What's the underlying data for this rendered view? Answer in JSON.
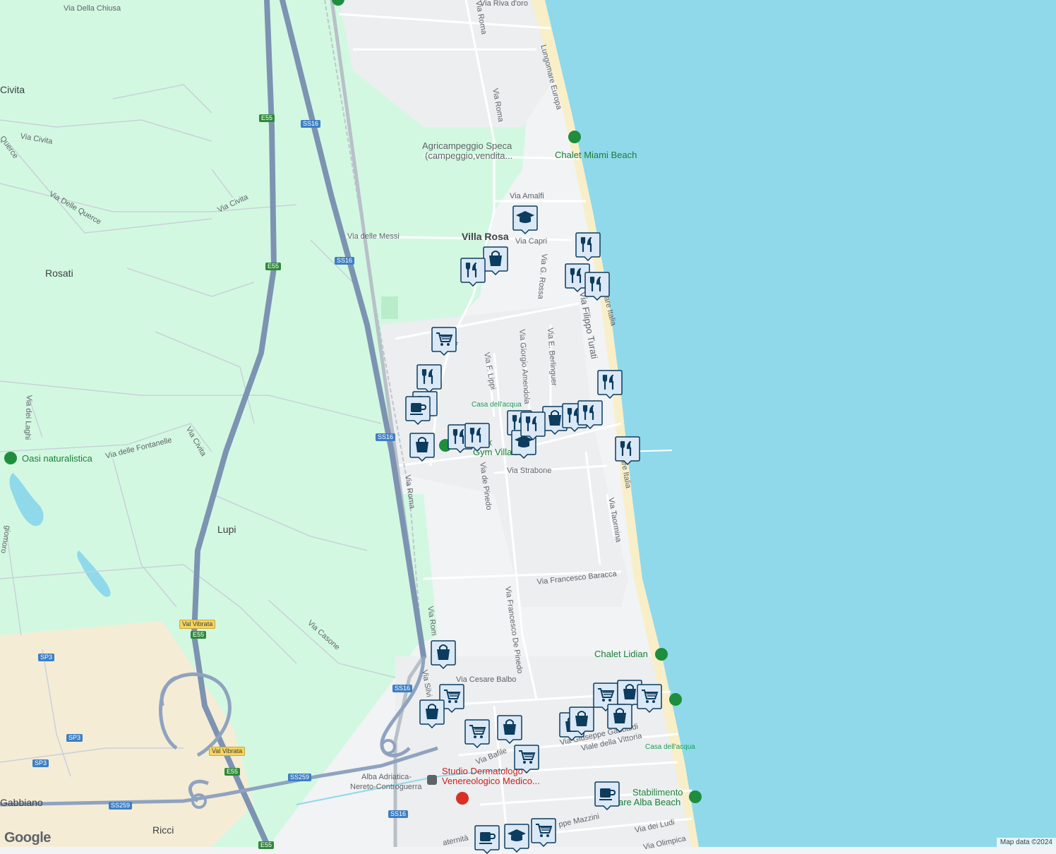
{
  "colors": {
    "sea": "#8fd9ea",
    "land": "#f1f3f4",
    "green": "#d3f8e2",
    "farmland": "#f5ecd6",
    "highway": "#7d93b2",
    "road": "#ffffff",
    "beach": "#f8efc9",
    "pin": "#0c3c5e",
    "pin_fill": "#dbe8f5"
  },
  "places": {
    "civita": "Civita",
    "rosati": "Rosati",
    "lupi": "Lupi",
    "villa_rosa": "Villa Rosa",
    "gabbiano": "Gabbiano",
    "ricci": "Ricci"
  },
  "streets": {
    "via_della_chiusa": "Via Della Chiusa",
    "via_riva_doro": "Via Riva d'oro",
    "via_roma_1": "Via Roma",
    "via_roma_2": "Via Roma",
    "via_roma_3": "Via Roma",
    "via_roma_4": "Via Rom",
    "lungomare_europa": "Lungomare Europa",
    "via_civita_1": "Via Civita",
    "via_civita_2": "Via Civita",
    "via_civita_3": "Via Civita",
    "via_quercie": "Querce",
    "via_delle_querce": "Via Delle Querce",
    "via_amalfi": "Via Amalfi",
    "via_delle_messi": "Via delle Messi",
    "via_capri": "Via Capri",
    "via_g_rossa": "Via G. Rossa",
    "via_filippo_turati": "Via Filippo Turati",
    "lungomare_italia_1": "omare Italia",
    "lungomare_italia_2": "mare Italia",
    "via_giorgio_amendola": "Via Giorgio Amendola",
    "via_e_berlinguer": "Via E. Berlinguer",
    "via_f_lippi": "Via F. Lippi",
    "via_dei_laghi": "Via dei Laghi",
    "via_delle_fontanelle": "Via delle Fontanelle",
    "via_strabone": "Via Strabone",
    "via_de_pinedo": "Via de Pinedo",
    "via_taormina": "Via Taormina",
    "via_francesco_baracca": "Via Francesco Baracca",
    "via_francesco_de_pinedo": "Via Francesco De Pinedo",
    "via_casone": "Via Casone",
    "via_cesare_balbo": "Via Cesare Balbo",
    "via_silvio": "Via Silvi",
    "via_bafile": "Via Bafile",
    "viale_della_vittoria": "Viale della Vittoria",
    "via_giuseppe_garibaldi": "Via Giuseppe Garibaldi",
    "via_mazzini": "ppe Mazzini",
    "via_dei_ludi": "Via dei Ludi",
    "via_olimpica": "Via Olimpica",
    "via_maternita": "aternità",
    "giomoro": "giomoro",
    "via_vita": "Via"
  },
  "pois": {
    "agricampeggio_line1": "Agricampeggio Speca",
    "agricampeggio_line2": "(campeggio,vendita...",
    "chalet_miami_beach": "Chalet Miami Beach",
    "oasi_naturalistica": "Oasi naturalistica",
    "casa_acqua_1": "Casa dell'acqua",
    "casa_acqua_2": "Casa dell'acqua",
    "gym_line1": "Lux",
    "gym_line2": "Gym Villa Ro...",
    "chalet_lidian": "Chalet Lidian",
    "alba_station_line1": "Alba Adriatica-",
    "alba_station_line2": "Nereto-Controguerra",
    "studio_line1": "Studio Dermatologo",
    "studio_line2": "Venereologico Medico...",
    "stabilimento_line1": "Stabilimento",
    "stabilimento_line2": "are Alba Beach"
  },
  "shields": {
    "e55_a": "E55",
    "ss16_a": "SS16",
    "e55_b": "E55",
    "ss16_b": "SS16",
    "ss16_c": "SS16",
    "val_vibrata_a": "Val Vibrata",
    "e55_c": "E55",
    "sp3_a": "SP3",
    "ss16_d": "SS16",
    "sp3_b": "SP3",
    "sp3_c": "SP3",
    "val_vibrata_b": "Val Vibrata",
    "e55_d": "E55",
    "ss259_a": "SS259",
    "ss259_b": "SS259",
    "ss16_e": "SS16",
    "e55_e": "E55"
  },
  "pins": [
    {
      "icon": "school-icon"
    },
    {
      "icon": "restaurant-icon"
    },
    {
      "icon": "shopping-icon"
    },
    {
      "icon": "restaurant-icon"
    },
    {
      "icon": "restaurant-icon"
    },
    {
      "icon": "restaurant-icon"
    },
    {
      "icon": "grocery-icon"
    },
    {
      "icon": "restaurant-icon"
    },
    {
      "icon": "restaurant-icon"
    },
    {
      "icon": "cafe-icon"
    },
    {
      "icon": "restaurant-icon"
    },
    {
      "icon": "restaurant-icon"
    },
    {
      "icon": "shopping-icon"
    },
    {
      "icon": "restaurant-icon"
    },
    {
      "icon": "restaurant-icon"
    },
    {
      "icon": "restaurant-icon"
    },
    {
      "icon": "shopping-icon"
    },
    {
      "icon": "restaurant-icon"
    },
    {
      "icon": "restaurant-icon"
    },
    {
      "icon": "school-icon"
    },
    {
      "icon": "restaurant-icon"
    },
    {
      "icon": "shopping-icon"
    },
    {
      "icon": "grocery-icon"
    },
    {
      "icon": "shopping-icon"
    },
    {
      "icon": "grocery-icon"
    },
    {
      "icon": "shopping-icon"
    },
    {
      "icon": "grocery-icon"
    },
    {
      "icon": "grocery-icon"
    },
    {
      "icon": "shopping-icon"
    },
    {
      "icon": "grocery-icon"
    },
    {
      "icon": "shopping-icon"
    },
    {
      "icon": "shopping-icon"
    },
    {
      "icon": "shopping-icon"
    },
    {
      "icon": "cafe-icon"
    },
    {
      "icon": "cafe-icon"
    },
    {
      "icon": "school-icon"
    },
    {
      "icon": "grocery-icon"
    }
  ],
  "footer": {
    "logo": "Google",
    "attribution": "Map data ©2024"
  }
}
